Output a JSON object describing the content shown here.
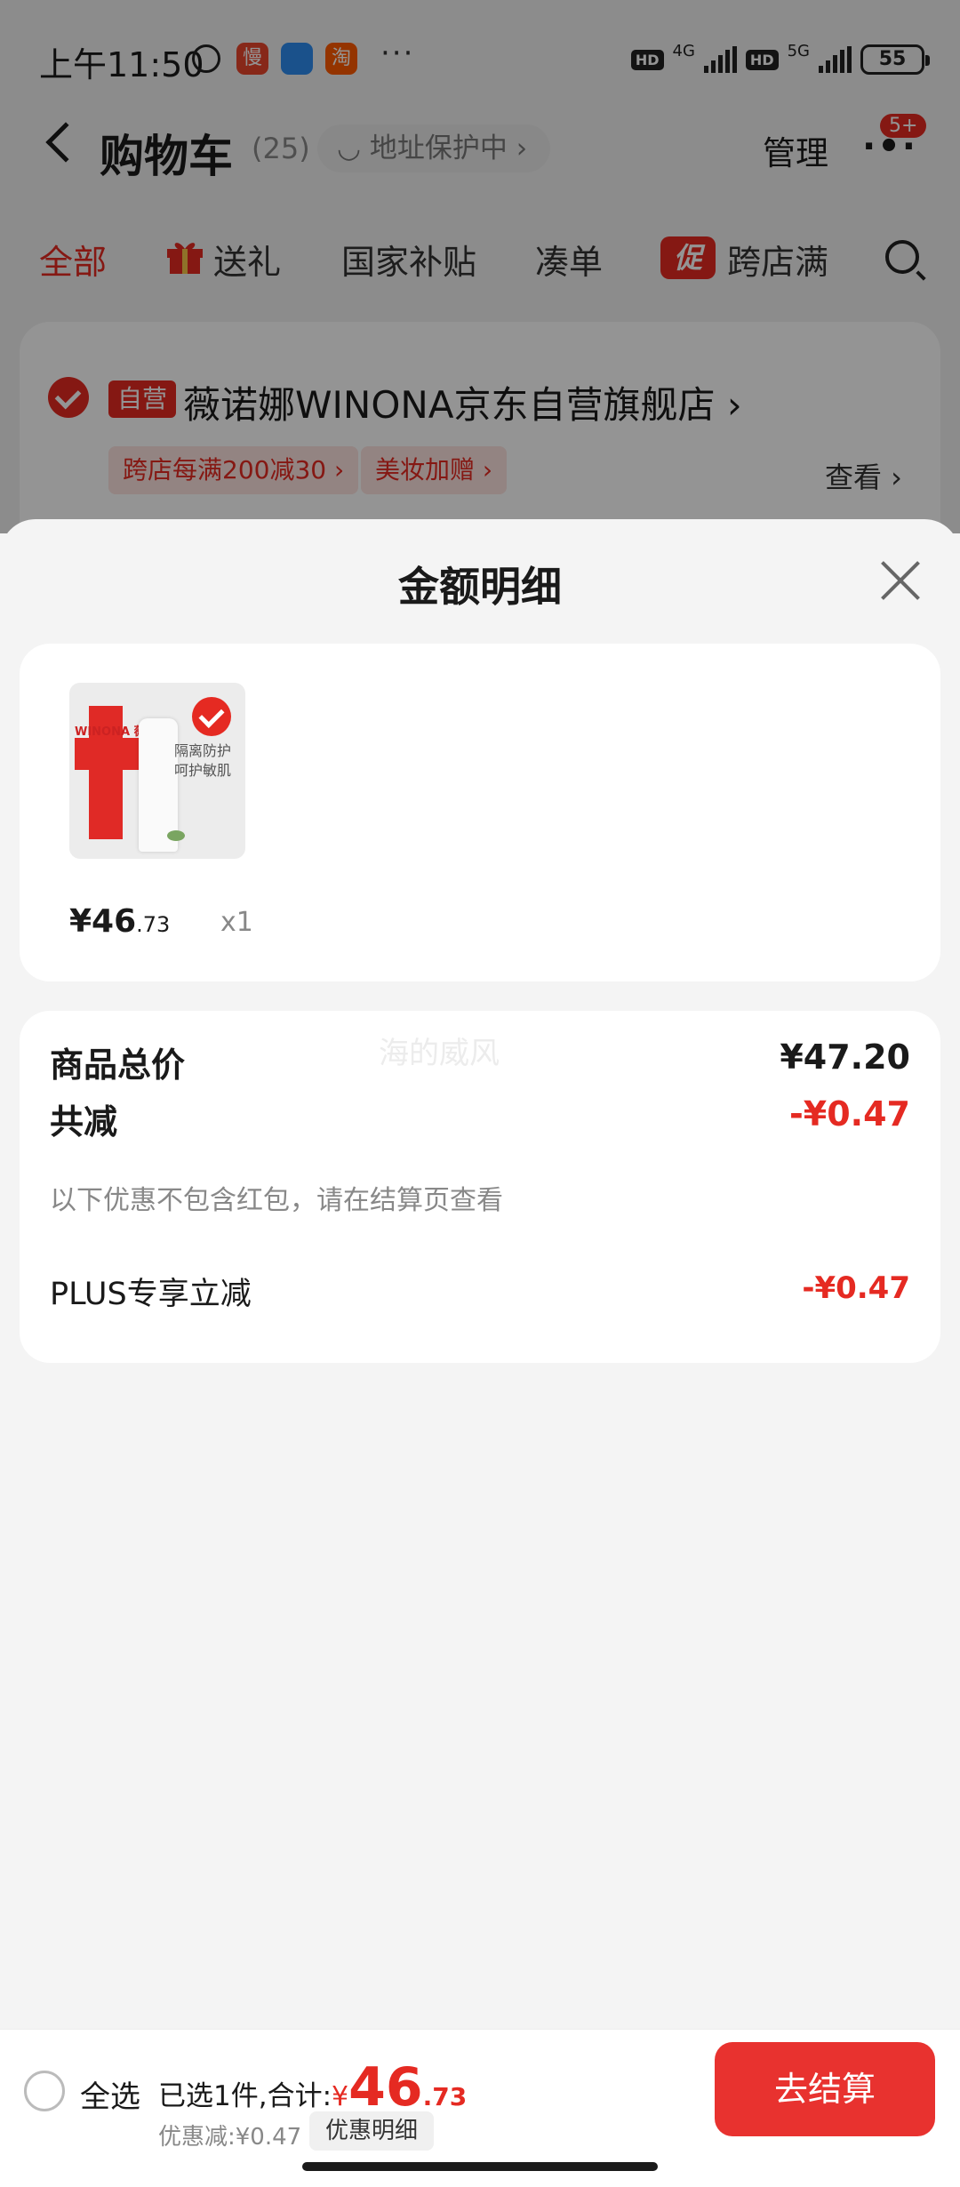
{
  "status_bar": {
    "time": "上午11:50",
    "apps": [
      "慢",
      "淘"
    ],
    "network_1": "4G",
    "network_2": "5G",
    "battery": "55"
  },
  "nav": {
    "title": "购物车",
    "count": "(25)",
    "address_protect": "地址保护中 ›",
    "manage": "管理",
    "more_badge": "5+"
  },
  "tabs": [
    {
      "label": "全部"
    },
    {
      "label": "送礼"
    },
    {
      "label": "国家补贴"
    },
    {
      "label": "凑单"
    },
    {
      "label": "跨店满"
    }
  ],
  "promo_tag": "促",
  "store": {
    "self_tag": "自营",
    "name": "薇诺娜WINONA京东自营旗舰店 ›",
    "chips": [
      "跨店每满200减30 ›",
      "美妆加赠 ›"
    ],
    "view": "查看 ›"
  },
  "sheet": {
    "title": "金额明细",
    "product": {
      "brand": "WINONA 薇诺娜",
      "caption": "隔离防护 呵护敏肌",
      "price_int": "¥46",
      "price_dec": ".73",
      "qty": "x1"
    },
    "watermark": "海的威风",
    "rows": {
      "total_label": "商品总价",
      "total_value": "¥47.20",
      "reduce_label": "共减",
      "reduce_value": "-¥0.47",
      "note": "以下优惠不包含红包，请在结算页查看",
      "plus_label": "PLUS专享立减",
      "plus_value": "-¥0.47"
    }
  },
  "bottom": {
    "select_all": "全选",
    "selected_text": "已选1件,合计:",
    "currency": "¥",
    "total_int": "46",
    "total_dec": ".73",
    "discount": "优惠减:¥0.47",
    "detail_btn": "优惠明细",
    "checkout": "去结算"
  },
  "colors": {
    "accent": "#e52a22",
    "background": "#f4f4f4"
  }
}
